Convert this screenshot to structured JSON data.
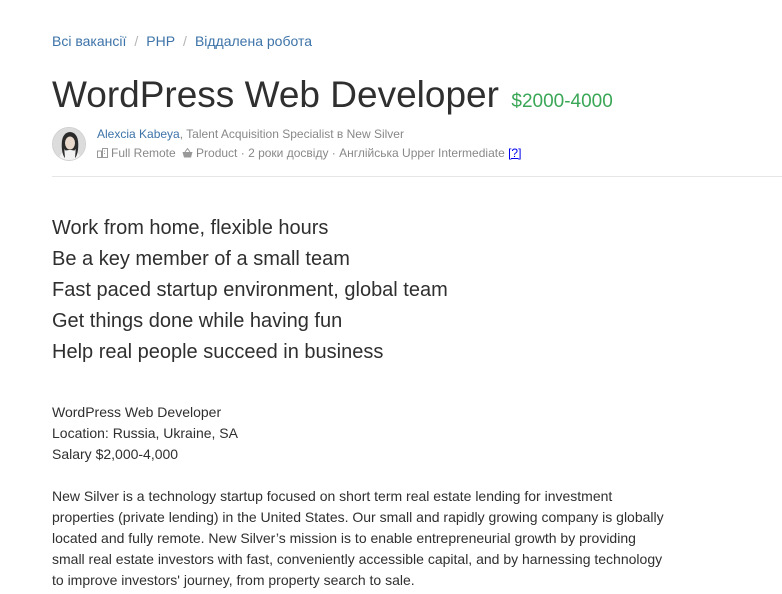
{
  "breadcrumb": {
    "items": [
      "Всі вакансії",
      "PHP",
      "Віддалена робота"
    ],
    "separator": "/"
  },
  "job": {
    "title": "WordPress Web Developer",
    "salary": "$2000-4000"
  },
  "recruiter": {
    "name": "Alexcia Kabeya",
    "role": ", Talent Acquisition Specialist в New Silver"
  },
  "tags": {
    "remote": "Full Remote",
    "product": "Product",
    "sep": "·",
    "experience": "2 роки досвіду",
    "english": "Англійська Upper Intermediate",
    "help_link": "[?]"
  },
  "highlights": [
    "Work from home, flexible hours",
    "Be a key member of a small team",
    "Fast paced startup environment, global team",
    "Get things done while having fun",
    "Help real people succeed in business"
  ],
  "details": [
    "WordPress Web Developer",
    "Location: Russia, Ukraine, SA",
    "Salary $2,000-4,000"
  ],
  "description": "New Silver is a technology startup focused on short term real estate lending for investment properties (private lending) in the United States. Our small and rapidly growing company is globally located and fully remote. New Silver’s mission is to enable entrepreneurial growth by providing small real estate investors with fast, conveniently accessible capital, and by harnessing technology to improve investors' journey, from property search to sale.",
  "colors": {
    "link": "#3d73a8",
    "salary": "#3aa757"
  },
  "icons": {
    "remote": "building-icon",
    "product": "basket-icon"
  }
}
